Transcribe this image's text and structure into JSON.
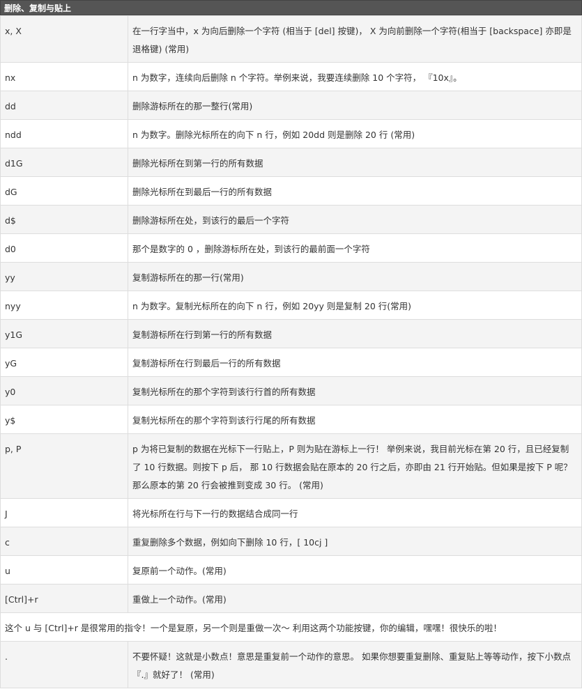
{
  "header": {
    "title": "删除、复制与贴上"
  },
  "rows": [
    {
      "cmd": "x, X",
      "desc": "在一行字当中，x 为向后删除一个字符 (相当于 [del] 按键)， X 为向前删除一个字符(相当于 [backspace] 亦即是退格键) (常用)"
    },
    {
      "cmd": "nx",
      "desc": "n 为数字，连续向后删除 n 个字符。举例来说，我要连续删除 10 个字符， 『10x』。"
    },
    {
      "cmd": "dd",
      "desc": "删除游标所在的那一整行(常用)"
    },
    {
      "cmd": "ndd",
      "desc": "n 为数字。删除光标所在的向下 n 行，例如 20dd 则是删除 20 行 (常用)"
    },
    {
      "cmd": "d1G",
      "desc": "删除光标所在到第一行的所有数据"
    },
    {
      "cmd": "dG",
      "desc": "删除光标所在到最后一行的所有数据"
    },
    {
      "cmd": "d$",
      "desc": "删除游标所在处，到该行的最后一个字符"
    },
    {
      "cmd": "d0",
      "desc": "那个是数字的 0 ，删除游标所在处，到该行的最前面一个字符"
    },
    {
      "cmd": "yy",
      "desc": "复制游标所在的那一行(常用)"
    },
    {
      "cmd": "nyy",
      "desc": "n 为数字。复制光标所在的向下 n 行，例如 20yy 则是复制 20 行(常用)"
    },
    {
      "cmd": "y1G",
      "desc": "复制游标所在行到第一行的所有数据"
    },
    {
      "cmd": "yG",
      "desc": "复制游标所在行到最后一行的所有数据"
    },
    {
      "cmd": "y0",
      "desc": "复制光标所在的那个字符到该行行首的所有数据"
    },
    {
      "cmd": "y$",
      "desc": "复制光标所在的那个字符到该行行尾的所有数据"
    },
    {
      "cmd": "p, P",
      "desc": "p 为将已复制的数据在光标下一行贴上，P 则为贴在游标上一行！ 举例来说，我目前光标在第 20 行，且已经复制了 10 行数据。则按下 p 后， 那 10 行数据会贴在原本的 20 行之后，亦即由 21 行开始贴。但如果是按下 P 呢？ 那么原本的第 20 行会被推到变成 30 行。 (常用)"
    },
    {
      "cmd": "J",
      "desc": "将光标所在行与下一行的数据结合成同一行"
    },
    {
      "cmd": "c",
      "desc": "重复删除多个数据，例如向下删除 10 行，[ 10cj ]"
    },
    {
      "cmd": "u",
      "desc": "复原前一个动作。(常用)"
    },
    {
      "cmd": "[Ctrl]+r",
      "desc": "重做上一个动作。(常用)"
    }
  ],
  "note": "这个 u 与 [Ctrl]+r 是很常用的指令！一个是复原，另一个则是重做一次～ 利用这两个功能按键，你的编辑，嘿嘿！很快乐的啦！",
  "last_row": {
    "cmd": ".",
    "desc": "不要怀疑！这就是小数点！意思是重复前一个动作的意思。 如果你想要重复删除、重复贴上等等动作，按下小数点『.』就好了！ (常用)"
  }
}
